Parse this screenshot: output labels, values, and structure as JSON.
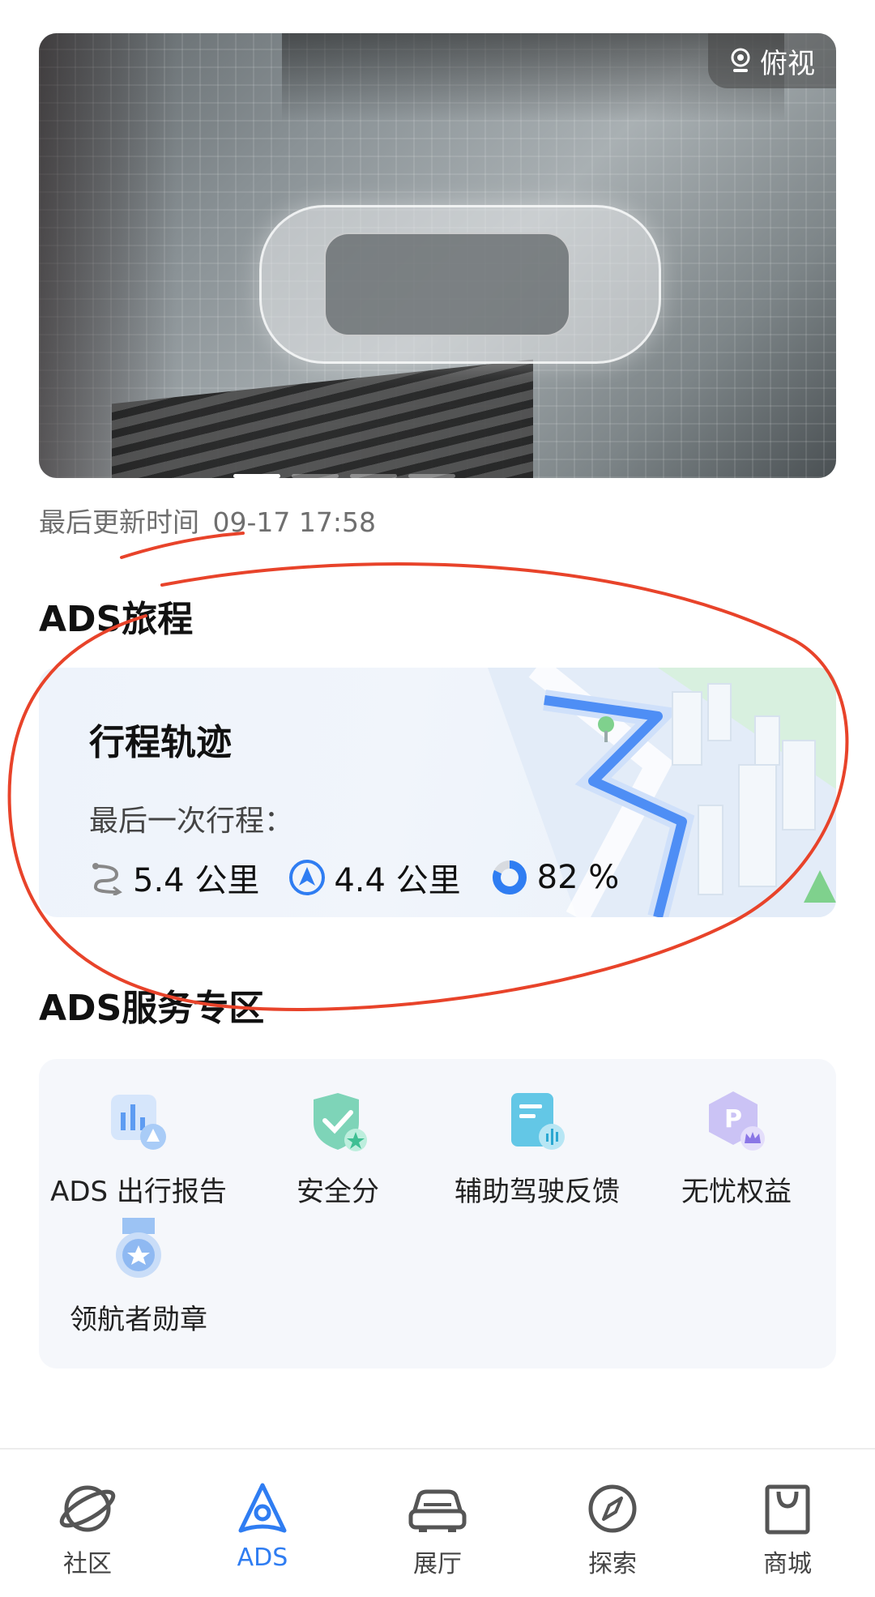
{
  "camera": {
    "view_label": "俯视",
    "carousel_page": 1,
    "carousel_total": 4
  },
  "update_time": {
    "label": "最后更新时间",
    "value": "09-17 17:58"
  },
  "journey": {
    "section_title": "ADS旅程",
    "card_title": "行程轨迹",
    "last_trip_label": "最后一次行程：",
    "stats": [
      {
        "icon": "route-icon",
        "value": "5.4 公里"
      },
      {
        "icon": "navigation-icon",
        "value": "4.4 公里"
      },
      {
        "icon": "donut-progress-icon",
        "value": "82 %",
        "progress": 0.82
      }
    ]
  },
  "services": {
    "section_title": "ADS服务专区",
    "items": [
      {
        "label": "ADS 出行报告",
        "icon": "report-chart-icon"
      },
      {
        "label": "安全分",
        "icon": "shield-check-icon"
      },
      {
        "label": "辅助驾驶反馈",
        "icon": "feedback-doc-icon"
      },
      {
        "label": "无忧权益",
        "icon": "premium-p-icon"
      },
      {
        "label": "领航者勋章",
        "icon": "medal-icon"
      }
    ]
  },
  "nav": {
    "active": "ADS",
    "items": [
      {
        "label": "社区",
        "icon": "planet-icon"
      },
      {
        "label": "ADS",
        "icon": "ads-icon"
      },
      {
        "label": "展厅",
        "icon": "car-icon"
      },
      {
        "label": "探索",
        "icon": "compass-icon"
      },
      {
        "label": "商城",
        "icon": "shopping-bag-icon"
      }
    ]
  },
  "colors": {
    "accent": "#2f7df2",
    "annotation": "#e8432a"
  }
}
